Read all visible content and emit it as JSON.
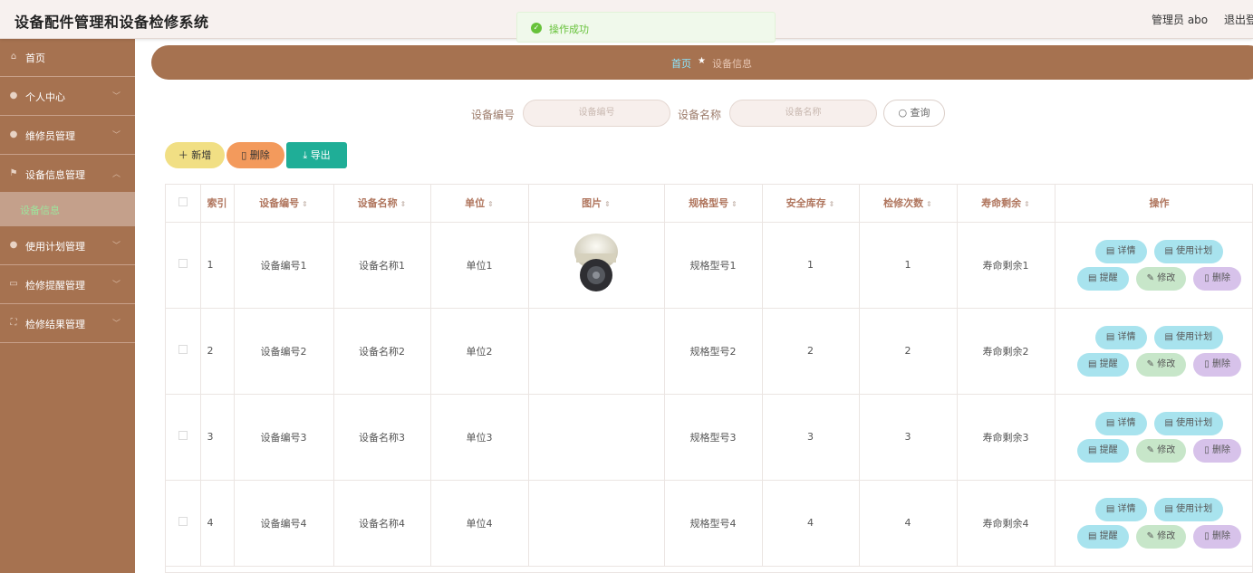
{
  "header": {
    "title": "设备配件管理和设备检修系统",
    "user": "管理员 abo",
    "logout": "退出登"
  },
  "toast": {
    "message": "操作成功"
  },
  "sidebar": {
    "items": [
      {
        "label": "首页",
        "icon": "home-icon"
      },
      {
        "label": "个人中心",
        "icon": "user-icon"
      },
      {
        "label": "维修员管理",
        "icon": "pin-icon"
      },
      {
        "label": "设备信息管理",
        "icon": "flag-icon"
      },
      {
        "label": "使用计划管理",
        "icon": "user-icon"
      },
      {
        "label": "检修提醒管理",
        "icon": "card-icon"
      },
      {
        "label": "检修结果管理",
        "icon": "frame-icon"
      }
    ],
    "sub_item": "设备信息"
  },
  "breadcrumb": {
    "home": "首页",
    "separator": "★",
    "current": "设备信息"
  },
  "search": {
    "code_label": "设备编号",
    "code_placeholder": "设备编号",
    "name_label": "设备名称",
    "name_placeholder": "设备名称",
    "query": "查询"
  },
  "actions": {
    "add": "新增",
    "delete": "删除",
    "export": "导出"
  },
  "table": {
    "columns": [
      "索引",
      "设备编号",
      "设备名称",
      "单位",
      "图片",
      "规格型号",
      "安全库存",
      "检修次数",
      "寿命剩余",
      "操作"
    ],
    "rows": [
      {
        "index": "1",
        "code": "设备编号1",
        "name": "设备名称1",
        "unit": "单位1",
        "spec": "规格型号1",
        "stock": "1",
        "repairs": "1",
        "life": "寿命剩余1",
        "has_image": true
      },
      {
        "index": "2",
        "code": "设备编号2",
        "name": "设备名称2",
        "unit": "单位2",
        "spec": "规格型号2",
        "stock": "2",
        "repairs": "2",
        "life": "寿命剩余2",
        "has_image": false
      },
      {
        "index": "3",
        "code": "设备编号3",
        "name": "设备名称3",
        "unit": "单位3",
        "spec": "规格型号3",
        "stock": "3",
        "repairs": "3",
        "life": "寿命剩余3",
        "has_image": false
      },
      {
        "index": "4",
        "code": "设备编号4",
        "name": "设备名称4",
        "unit": "单位4",
        "spec": "规格型号4",
        "stock": "4",
        "repairs": "4",
        "life": "寿命剩余4",
        "has_image": false
      }
    ],
    "ops": {
      "detail": "详情",
      "plan": "使用计划",
      "remind": "提醒",
      "edit": "修改",
      "delete": "删除"
    }
  },
  "colors": {
    "brand": "#a67250",
    "accent_cyan": "#a8e3ee",
    "success": "#67c23a"
  }
}
